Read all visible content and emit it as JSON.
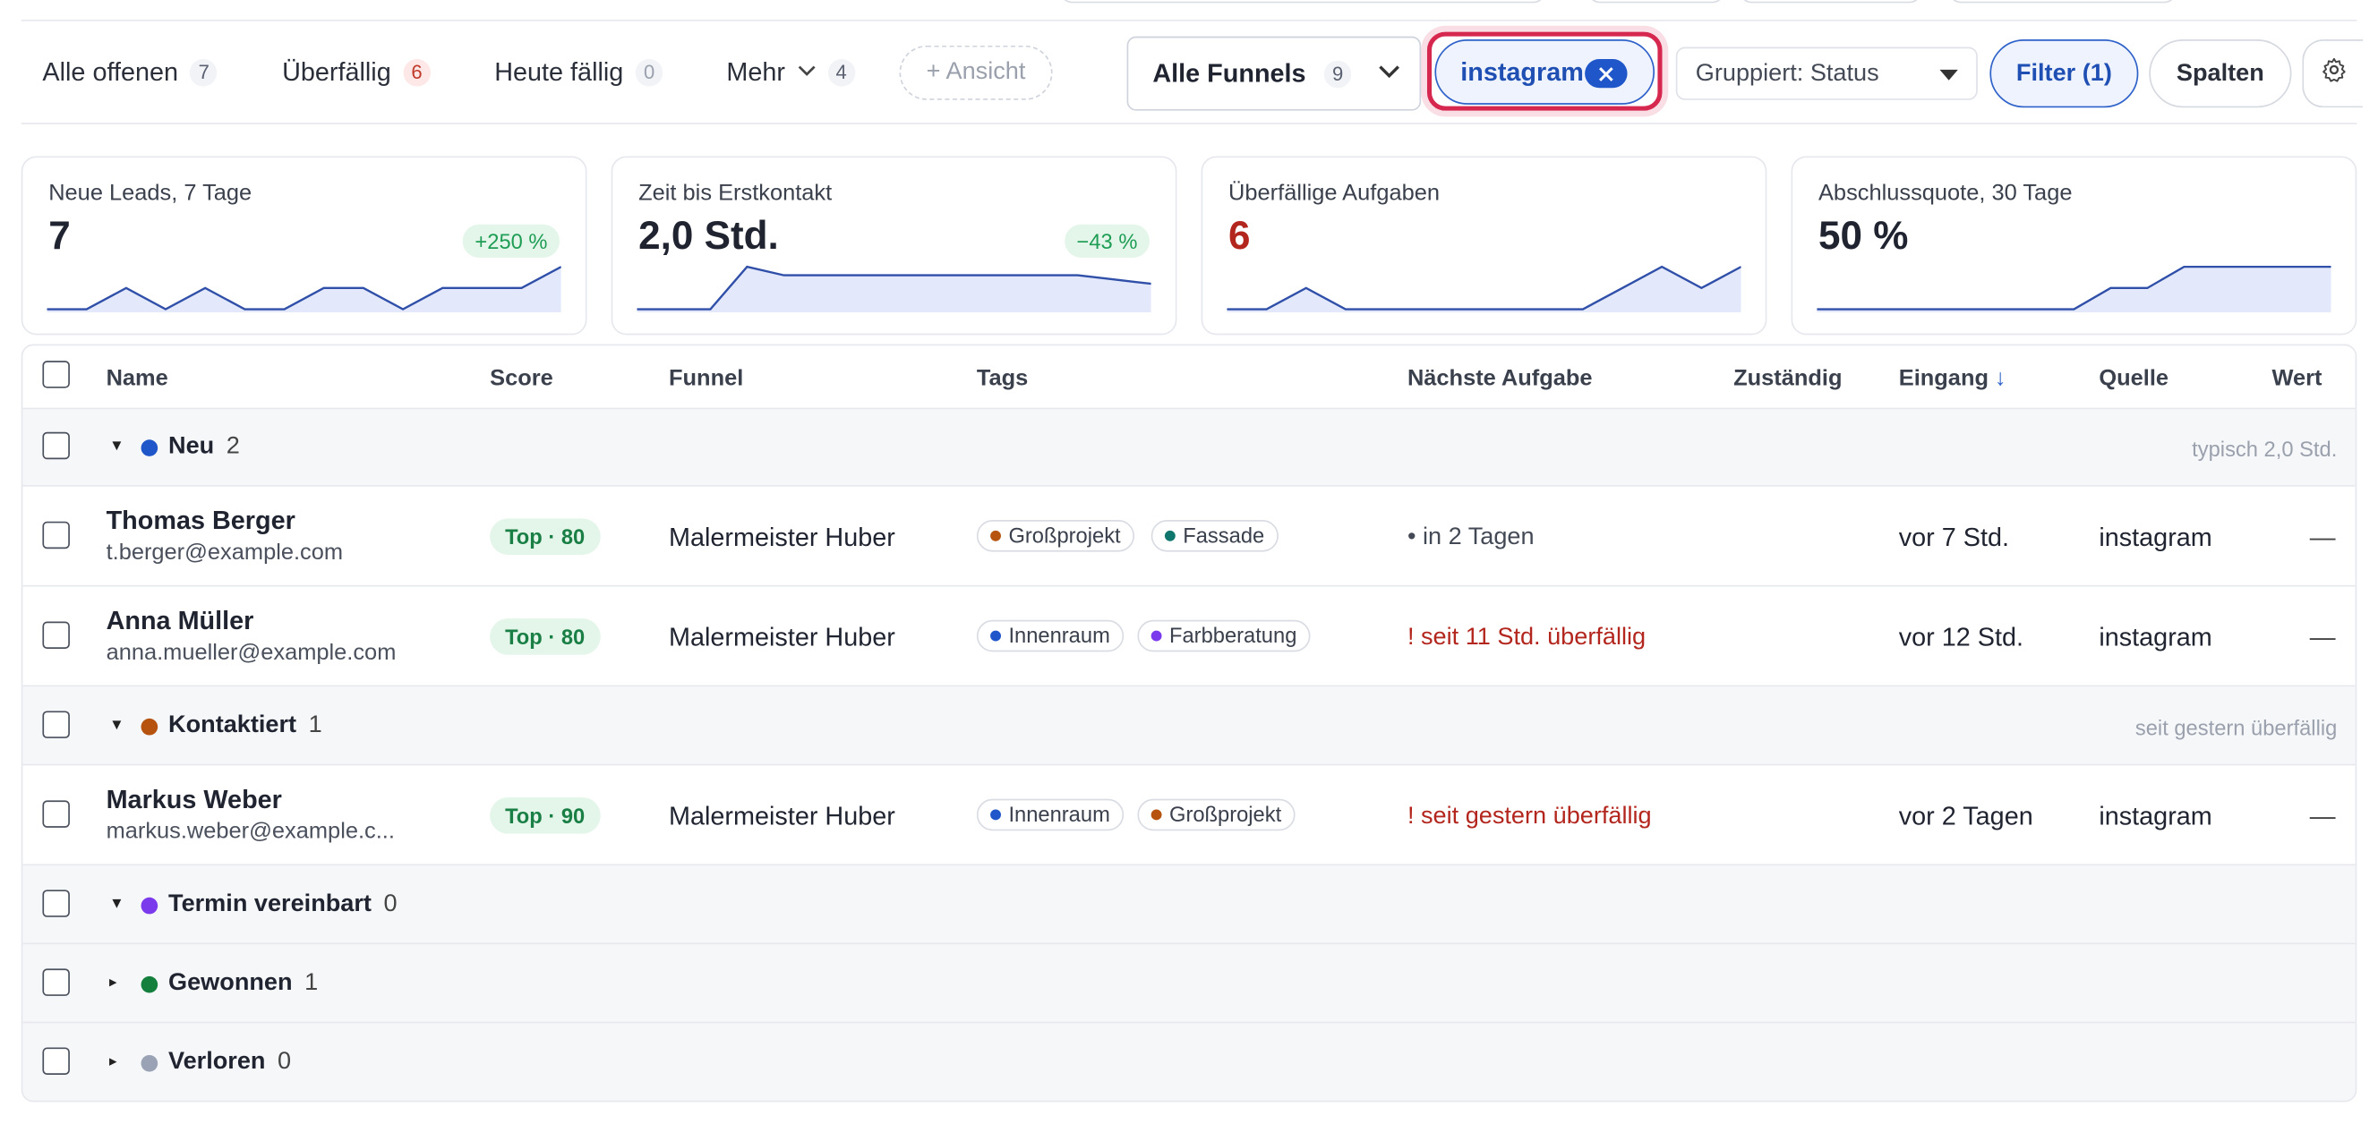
{
  "views": [
    {
      "label": "Alle offenen",
      "count": "7"
    },
    {
      "label": "Überfällig",
      "count": "6"
    },
    {
      "label": "Heute fällig",
      "count": "0"
    },
    {
      "label": "Mehr",
      "count": "4"
    }
  ],
  "add_view_label": "+ Ansicht",
  "funnel_select": {
    "label": "Alle Funnels",
    "count": "9"
  },
  "filter_chip": {
    "label": "instagram"
  },
  "group_select": {
    "label": "Gruppiert: Status"
  },
  "filter_button": "Filter (1)",
  "columns_button": "Spalten",
  "kpis": [
    {
      "title": "Neue Leads, 7 Tage",
      "value": "7",
      "delta": "+250 %",
      "spark": [
        0,
        0,
        1,
        0,
        1,
        0,
        0,
        1,
        1,
        0,
        1,
        1,
        1,
        2
      ]
    },
    {
      "title": "Zeit bis Erstkontakt",
      "value": "2,0 Std.",
      "delta": "−43 %",
      "spark": [
        0,
        0,
        0,
        2,
        1.6,
        1.6,
        1.6,
        1.6,
        1.6,
        1.6,
        1.6,
        1.6,
        1.6,
        1.4,
        1.2
      ]
    },
    {
      "title": "Überfällige Aufgaben",
      "value": "6",
      "delta": "",
      "spark": [
        0,
        0,
        1,
        0,
        0,
        0,
        0,
        0,
        0,
        0,
        1,
        2,
        1,
        2
      ]
    },
    {
      "title": "Abschlussquote, 30 Tage",
      "value": "50 %",
      "delta": "",
      "spark": [
        0,
        0,
        0,
        0,
        0,
        0,
        0,
        0,
        1,
        1,
        2,
        2,
        2,
        2,
        2
      ]
    }
  ],
  "columns": {
    "name": "Name",
    "score": "Score",
    "funnel": "Funnel",
    "tags": "Tags",
    "next_task": "Nächste Aufgabe",
    "owner": "Zuständig",
    "received": "Eingang",
    "source": "Quelle",
    "value": "Wert"
  },
  "groups": {
    "neu": {
      "name": "Neu",
      "count": "2",
      "hint": "typisch 2,0 Std.",
      "color": "#1f56c9"
    },
    "kontaktiert": {
      "name": "Kontaktiert",
      "count": "1",
      "hint": "seit gestern überfällig",
      "color": "#b5530f"
    },
    "termin": {
      "name": "Termin vereinbart",
      "count": "0",
      "color": "#7c3aed"
    },
    "gewonnen": {
      "name": "Gewonnen",
      "count": "1",
      "color": "#15803d"
    },
    "verloren": {
      "name": "Verloren",
      "count": "0",
      "color": "#9aa3b5"
    }
  },
  "leads": [
    {
      "name": "Thomas Berger",
      "email": "t.berger@example.com",
      "score": "Top · 80",
      "funnel": "Malermeister Huber",
      "tags": [
        {
          "label": "Großprojekt",
          "color": "#b5530f"
        },
        {
          "label": "Fassade",
          "color": "#0f766e"
        }
      ],
      "task": "• in 2 Tagen",
      "received": "vor 7 Std.",
      "source": "instagram",
      "value": "—"
    },
    {
      "name": "Anna Müller",
      "email": "anna.mueller@example.com",
      "score": "Top · 80",
      "funnel": "Malermeister Huber",
      "tags": [
        {
          "label": "Innenraum",
          "color": "#1f56c9"
        },
        {
          "label": "Farbberatung",
          "color": "#7c3aed"
        }
      ],
      "task": "! seit 11 Std. überfällig",
      "received": "vor 12 Std.",
      "source": "instagram",
      "value": "—"
    },
    {
      "name": "Markus Weber",
      "email": "markus.weber@example.c...",
      "score": "Top · 90",
      "funnel": "Malermeister Huber",
      "tags": [
        {
          "label": "Innenraum",
          "color": "#1f56c9"
        },
        {
          "label": "Großprojekt",
          "color": "#b5530f"
        }
      ],
      "task": "! seit gestern überfällig",
      "received": "vor 2 Tagen",
      "source": "instagram",
      "value": "—"
    }
  ]
}
